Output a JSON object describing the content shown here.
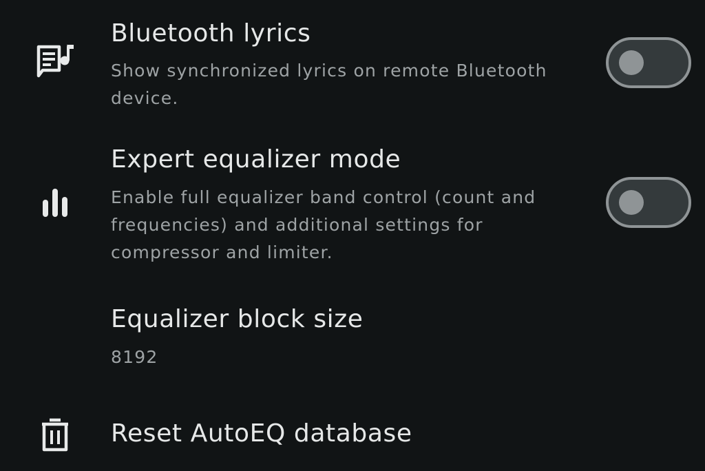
{
  "settings": [
    {
      "title": "Bluetooth lyrics",
      "summary": "Show synchronized lyrics on remote Bluetooth device.",
      "icon": "lyrics-icon",
      "toggle": false
    },
    {
      "title": "Expert equalizer mode",
      "summary": "Enable full equalizer band control (count and frequencies) and additional settings for compressor and limiter.",
      "icon": "equalizer-icon",
      "toggle": false
    },
    {
      "title": "Equalizer block size",
      "summary": "8192"
    },
    {
      "title": "Reset AutoEQ database",
      "icon": "trash-icon"
    }
  ],
  "colors": {
    "background": "#111415",
    "title_text": "#e6e8e8",
    "summary_text": "#9ea3a5",
    "switch_off_track": "#343a3c",
    "switch_off_outline": "#8f9496"
  }
}
